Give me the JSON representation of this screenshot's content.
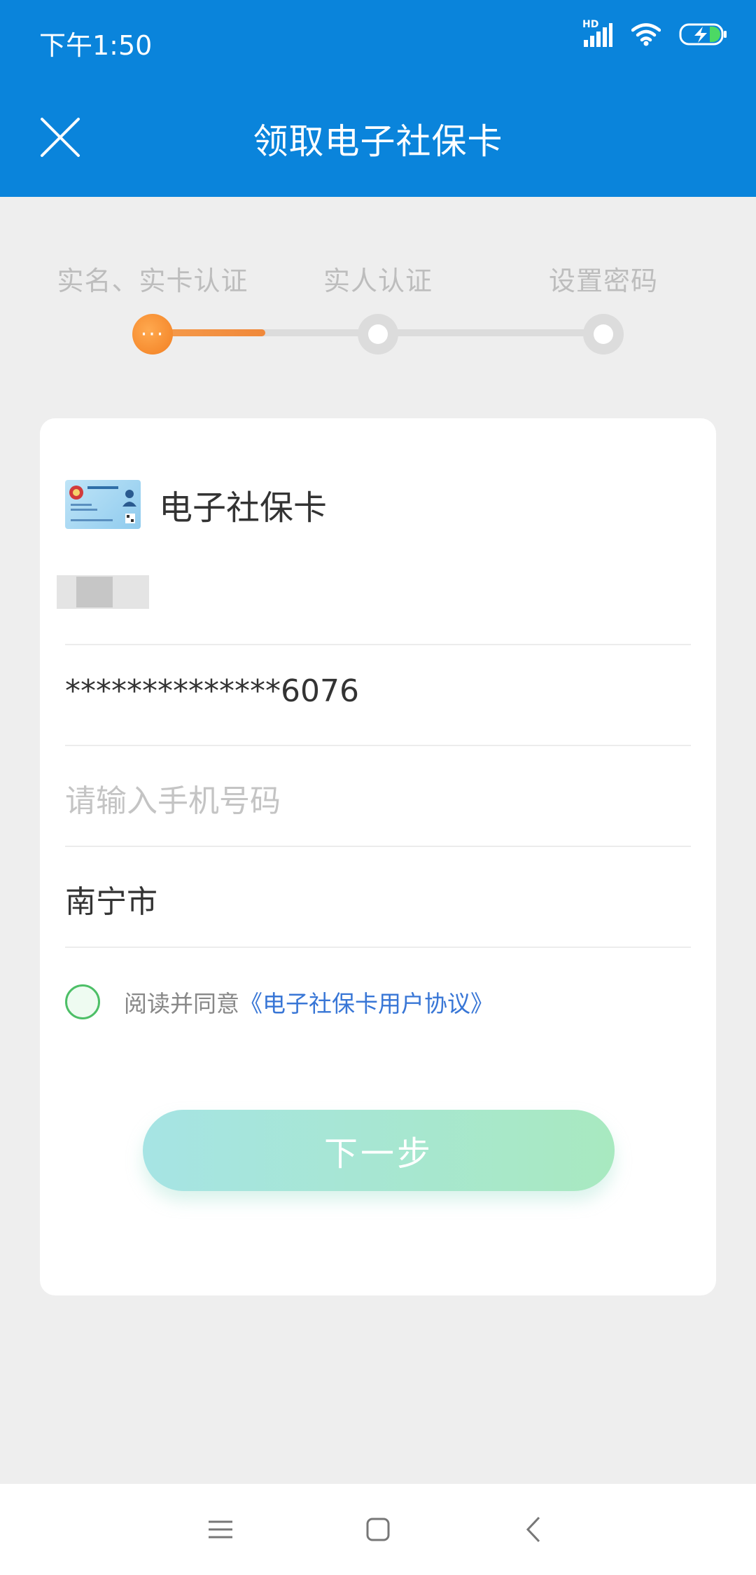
{
  "status_bar": {
    "time": "下午1:50",
    "hd_label": "HD",
    "icons": [
      "signal-icon",
      "wifi-icon",
      "battery-charging-icon"
    ]
  },
  "header": {
    "title": "领取电子社保卡",
    "close_icon": "close-icon",
    "background": "#0a84db"
  },
  "steps": [
    {
      "label": "实名、实卡认证",
      "state": "active"
    },
    {
      "label": "实人认证",
      "state": "pending"
    },
    {
      "label": "设置密码",
      "state": "pending"
    }
  ],
  "step_progress": 0.25,
  "card": {
    "title": "电子社保卡",
    "masked_id": "**************6076",
    "phone_placeholder": "请输入手机号码",
    "city": "南宁市",
    "agree_text": "阅读并同意",
    "agree_link": "《电子社保卡用户协议》",
    "next_button": "下一步"
  },
  "colors": {
    "accent_orange": "#f27f22",
    "link_blue": "#3876d6",
    "radio_green": "#4dbf67"
  },
  "nav": [
    "menu-icon",
    "home-icon",
    "back-icon"
  ]
}
